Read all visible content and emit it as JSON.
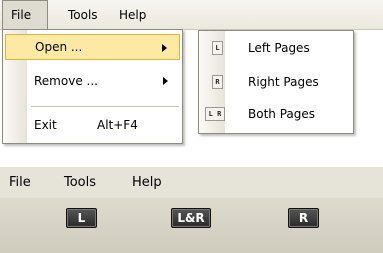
{
  "menubar": {
    "file": "File",
    "tools": "Tools",
    "help": "Help"
  },
  "file_menu": {
    "open": "Open ...",
    "remove": "Remove ...",
    "exit": "Exit",
    "exit_shortcut": "Alt+F4"
  },
  "open_submenu": {
    "items": [
      {
        "icon_text": "L",
        "label": "Left Pages"
      },
      {
        "icon_text": "R",
        "label": "Right Pages"
      },
      {
        "icon_text": "L R",
        "label": "Both Pages"
      }
    ]
  },
  "toolbar": {
    "left_button": "L",
    "both_button": "L&R",
    "right_button": "R"
  },
  "colors": {
    "menu_highlight": "#fde9a3",
    "menu_highlight_border": "#e3b43a",
    "toolbar_button": "#333333"
  }
}
